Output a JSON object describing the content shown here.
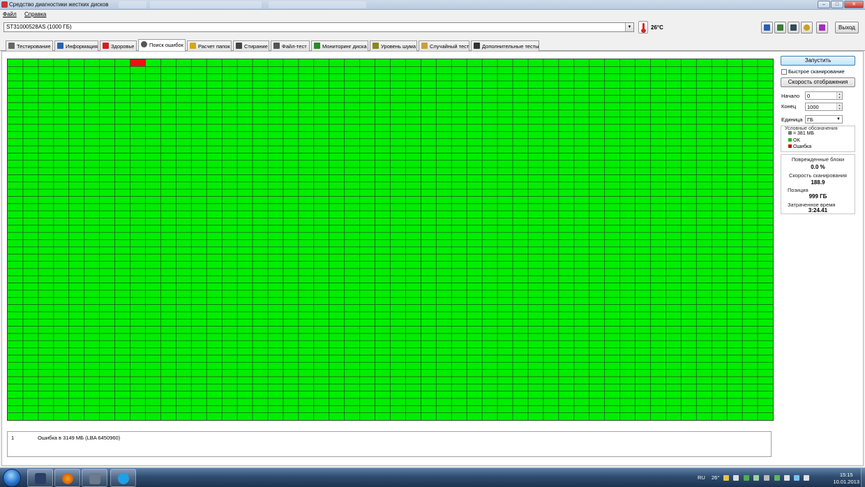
{
  "window": {
    "title": "Средство диагностики жестких дисков",
    "controls": {
      "minimize": "–",
      "maximize": "□",
      "close": "✕"
    }
  },
  "menu": [
    "Файл",
    "Справка"
  ],
  "toolbar": {
    "drive": "ST31000528AS (1000 ГБ)",
    "temperature": "26°C",
    "exit_label": "Выход",
    "icons": [
      "copy-icon",
      "copy-report-icon",
      "save-icon",
      "key-icon",
      "download-icon"
    ]
  },
  "tabs": [
    {
      "label": "Тестирование",
      "icon": "thermometer-icon",
      "color": "#666666"
    },
    {
      "label": "Информация",
      "icon": "info-icon",
      "color": "#2b5fb3"
    },
    {
      "label": "Здоровье",
      "icon": "health-cross-icon",
      "color": "#d02020"
    },
    {
      "label": "Поиск ошибок",
      "icon": "magnifier-icon",
      "color": "#555555",
      "active": true
    },
    {
      "label": "Расчет папок",
      "icon": "folder-icon",
      "color": "#d7a520"
    },
    {
      "label": "Стирание",
      "icon": "trash-icon",
      "color": "#444444"
    },
    {
      "label": "Файл-тест",
      "icon": "file-test-icon",
      "color": "#555555"
    },
    {
      "label": "Мониторинг диска",
      "icon": "monitor-icon",
      "color": "#2a8a2a"
    },
    {
      "label": "Уровень шума",
      "icon": "speaker-icon",
      "color": "#888820"
    },
    {
      "label": "Случайный тест",
      "icon": "random-icon",
      "color": "#c9a040"
    },
    {
      "label": "Дополнительные тесты",
      "icon": "extra-tests-icon",
      "color": "#333333"
    }
  ],
  "scan_map": {
    "columns": 50,
    "rows": 50,
    "ok_color": "#00ee00",
    "error_color": "#ee1111",
    "error_blocks": [
      {
        "row": 0,
        "col": 8
      }
    ]
  },
  "side_panel": {
    "start_label": "Запустить",
    "quick_scan_label": "Быстрое сканирование",
    "quick_scan_checked": false,
    "speed_label": "Скорость отображения",
    "start_field_label": "Начало",
    "start_value": "0",
    "end_field_label": "Конец",
    "end_value": "1000",
    "unit_label": "Единица",
    "unit_value": "ГБ",
    "legend": {
      "title": "Условные обозначения",
      "items": [
        {
          "label": "= 381 МБ",
          "color": "#777777"
        },
        {
          "label": "OK",
          "color": "#22bb22"
        },
        {
          "label": "Ошибка",
          "color": "#cc1111"
        }
      ]
    },
    "stats": {
      "damaged_label": "Поврежденные блоки",
      "damaged_value": "0.0 %",
      "speed_label": "Скорость сканирования",
      "speed_value": "188.9",
      "position_label": "Позиция",
      "position_value": "999 ГБ",
      "elapsed_label": "Затраченное время",
      "elapsed_value": "3:24.41"
    }
  },
  "error_log": [
    {
      "num": "1",
      "text": "Ошибка в 3149 МБ (LBA 6450960)"
    }
  ],
  "taskbar": {
    "apps": [
      "save-disk-icon",
      "firefox-icon",
      "drive-tool-icon",
      "skype-icon"
    ],
    "language": "RU",
    "temperature": "26°",
    "time": "15:15",
    "date": "10.01.2013"
  }
}
